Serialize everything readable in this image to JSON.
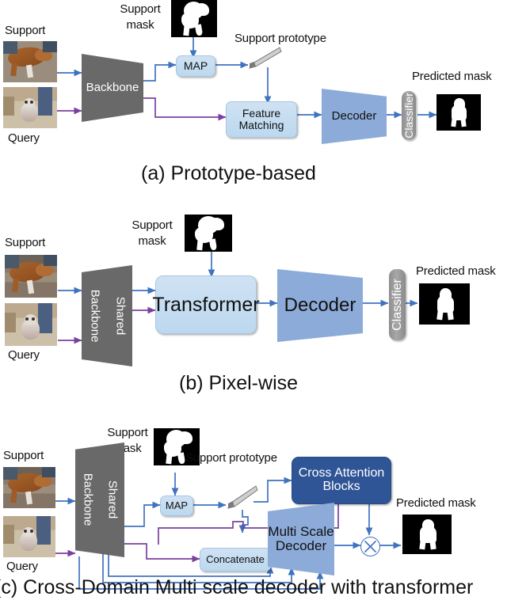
{
  "figure": {
    "panels": [
      {
        "id": "a",
        "caption": "(a) Prototype-based",
        "labels": {
          "support": "Support",
          "query": "Query",
          "support_mask": "Support\nmask",
          "support_mask_l1": "Support",
          "support_mask_l2": "mask",
          "support_prototype": "Support prototype",
          "predicted_mask": "Predicted mask"
        },
        "nodes": {
          "backbone": "Backbone",
          "map": "MAP",
          "feature_matching_l1": "Feature",
          "feature_matching_l2": "Matching",
          "decoder": "Decoder",
          "classifier": "Classifier"
        }
      },
      {
        "id": "b",
        "caption": "(b) Pixel-wise",
        "labels": {
          "support": "Support",
          "query": "Query",
          "support_mask_l1": "Support",
          "support_mask_l2": "mask",
          "predicted_mask": "Predicted mask"
        },
        "nodes": {
          "shared": "Shared",
          "backbone": "Backbone",
          "transformer": "Transformer",
          "decoder": "Decoder",
          "classifier": "Classifier"
        }
      },
      {
        "id": "c",
        "caption": "(c) Cross-Domain Multi scale decoder with transformer",
        "labels": {
          "support": "Support",
          "query": "Query",
          "support_mask_l1": "Support",
          "support_mask_l2": "mask",
          "support_prototype": "Support prototype",
          "predicted_mask": "Predicted mask"
        },
        "nodes": {
          "shared": "Shared",
          "backbone": "Backbone",
          "map": "MAP",
          "concatenate": "Concatenate",
          "cross_attention_l1": "Cross Attention",
          "cross_attention_l2": "Blocks",
          "multi_scale_l1": "Multi Scale",
          "multi_scale_l2": "Decoder",
          "multiply_symbol": "⊗"
        }
      }
    ],
    "colors": {
      "support_arrow": "#3f73bf",
      "query_arrow": "#7b3fa0",
      "backbone_fill": "#696969",
      "decoder_fill": "#8cabd9",
      "light_block_fill": "#c6dcf0",
      "cross_attention_fill": "#2f5597",
      "classifier_fill": "#9a9a9a",
      "mask_background": "#000000",
      "mask_foreground": "#ffffff"
    }
  }
}
